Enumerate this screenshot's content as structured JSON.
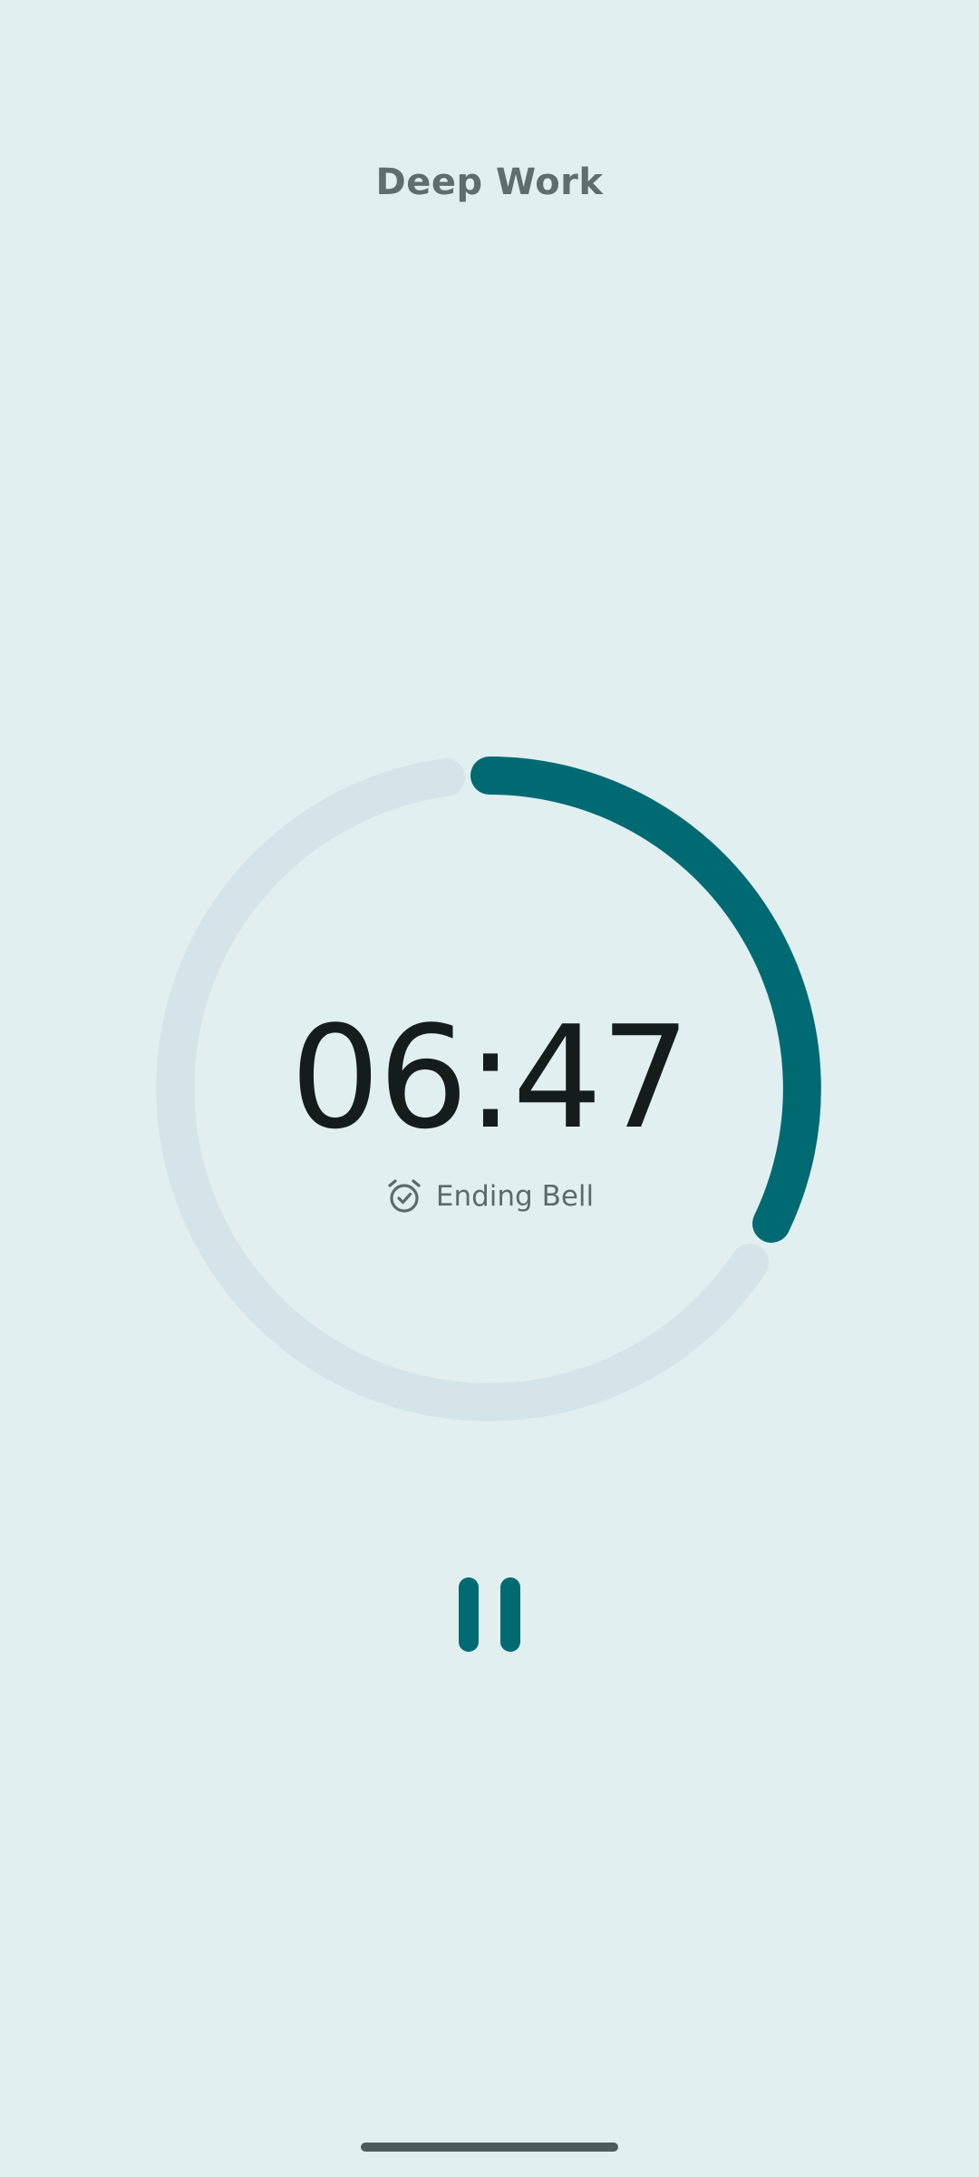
{
  "header": {
    "title": "Deep Work"
  },
  "timer": {
    "time_remaining": "06:47",
    "progress_fraction": 0.31,
    "bell_label": "Ending Bell",
    "bell_icon": "alarm-check-icon"
  },
  "controls": {
    "pause_icon": "pause-icon"
  },
  "colors": {
    "background": "#e1eff0",
    "accent": "#006a73",
    "track": "#d5e4e6",
    "time_text": "#141c1d",
    "secondary_text": "#5e6e6f"
  }
}
